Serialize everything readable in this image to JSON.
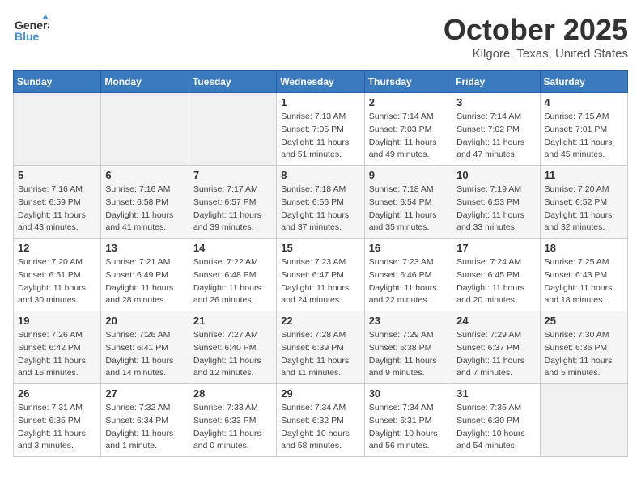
{
  "header": {
    "logo_general": "General",
    "logo_blue": "Blue",
    "month_title": "October 2025",
    "location": "Kilgore, Texas, United States"
  },
  "days_of_week": [
    "Sunday",
    "Monday",
    "Tuesday",
    "Wednesday",
    "Thursday",
    "Friday",
    "Saturday"
  ],
  "weeks": [
    [
      {
        "day": "",
        "sunrise": "",
        "sunset": "",
        "daylight": "",
        "empty": true
      },
      {
        "day": "",
        "sunrise": "",
        "sunset": "",
        "daylight": "",
        "empty": true
      },
      {
        "day": "",
        "sunrise": "",
        "sunset": "",
        "daylight": "",
        "empty": true
      },
      {
        "day": "1",
        "sunrise": "Sunrise: 7:13 AM",
        "sunset": "Sunset: 7:05 PM",
        "daylight": "Daylight: 11 hours and 51 minutes."
      },
      {
        "day": "2",
        "sunrise": "Sunrise: 7:14 AM",
        "sunset": "Sunset: 7:03 PM",
        "daylight": "Daylight: 11 hours and 49 minutes."
      },
      {
        "day": "3",
        "sunrise": "Sunrise: 7:14 AM",
        "sunset": "Sunset: 7:02 PM",
        "daylight": "Daylight: 11 hours and 47 minutes."
      },
      {
        "day": "4",
        "sunrise": "Sunrise: 7:15 AM",
        "sunset": "Sunset: 7:01 PM",
        "daylight": "Daylight: 11 hours and 45 minutes."
      }
    ],
    [
      {
        "day": "5",
        "sunrise": "Sunrise: 7:16 AM",
        "sunset": "Sunset: 6:59 PM",
        "daylight": "Daylight: 11 hours and 43 minutes."
      },
      {
        "day": "6",
        "sunrise": "Sunrise: 7:16 AM",
        "sunset": "Sunset: 6:58 PM",
        "daylight": "Daylight: 11 hours and 41 minutes."
      },
      {
        "day": "7",
        "sunrise": "Sunrise: 7:17 AM",
        "sunset": "Sunset: 6:57 PM",
        "daylight": "Daylight: 11 hours and 39 minutes."
      },
      {
        "day": "8",
        "sunrise": "Sunrise: 7:18 AM",
        "sunset": "Sunset: 6:56 PM",
        "daylight": "Daylight: 11 hours and 37 minutes."
      },
      {
        "day": "9",
        "sunrise": "Sunrise: 7:18 AM",
        "sunset": "Sunset: 6:54 PM",
        "daylight": "Daylight: 11 hours and 35 minutes."
      },
      {
        "day": "10",
        "sunrise": "Sunrise: 7:19 AM",
        "sunset": "Sunset: 6:53 PM",
        "daylight": "Daylight: 11 hours and 33 minutes."
      },
      {
        "day": "11",
        "sunrise": "Sunrise: 7:20 AM",
        "sunset": "Sunset: 6:52 PM",
        "daylight": "Daylight: 11 hours and 32 minutes."
      }
    ],
    [
      {
        "day": "12",
        "sunrise": "Sunrise: 7:20 AM",
        "sunset": "Sunset: 6:51 PM",
        "daylight": "Daylight: 11 hours and 30 minutes."
      },
      {
        "day": "13",
        "sunrise": "Sunrise: 7:21 AM",
        "sunset": "Sunset: 6:49 PM",
        "daylight": "Daylight: 11 hours and 28 minutes."
      },
      {
        "day": "14",
        "sunrise": "Sunrise: 7:22 AM",
        "sunset": "Sunset: 6:48 PM",
        "daylight": "Daylight: 11 hours and 26 minutes."
      },
      {
        "day": "15",
        "sunrise": "Sunrise: 7:23 AM",
        "sunset": "Sunset: 6:47 PM",
        "daylight": "Daylight: 11 hours and 24 minutes."
      },
      {
        "day": "16",
        "sunrise": "Sunrise: 7:23 AM",
        "sunset": "Sunset: 6:46 PM",
        "daylight": "Daylight: 11 hours and 22 minutes."
      },
      {
        "day": "17",
        "sunrise": "Sunrise: 7:24 AM",
        "sunset": "Sunset: 6:45 PM",
        "daylight": "Daylight: 11 hours and 20 minutes."
      },
      {
        "day": "18",
        "sunrise": "Sunrise: 7:25 AM",
        "sunset": "Sunset: 6:43 PM",
        "daylight": "Daylight: 11 hours and 18 minutes."
      }
    ],
    [
      {
        "day": "19",
        "sunrise": "Sunrise: 7:26 AM",
        "sunset": "Sunset: 6:42 PM",
        "daylight": "Daylight: 11 hours and 16 minutes."
      },
      {
        "day": "20",
        "sunrise": "Sunrise: 7:26 AM",
        "sunset": "Sunset: 6:41 PM",
        "daylight": "Daylight: 11 hours and 14 minutes."
      },
      {
        "day": "21",
        "sunrise": "Sunrise: 7:27 AM",
        "sunset": "Sunset: 6:40 PM",
        "daylight": "Daylight: 11 hours and 12 minutes."
      },
      {
        "day": "22",
        "sunrise": "Sunrise: 7:28 AM",
        "sunset": "Sunset: 6:39 PM",
        "daylight": "Daylight: 11 hours and 11 minutes."
      },
      {
        "day": "23",
        "sunrise": "Sunrise: 7:29 AM",
        "sunset": "Sunset: 6:38 PM",
        "daylight": "Daylight: 11 hours and 9 minutes."
      },
      {
        "day": "24",
        "sunrise": "Sunrise: 7:29 AM",
        "sunset": "Sunset: 6:37 PM",
        "daylight": "Daylight: 11 hours and 7 minutes."
      },
      {
        "day": "25",
        "sunrise": "Sunrise: 7:30 AM",
        "sunset": "Sunset: 6:36 PM",
        "daylight": "Daylight: 11 hours and 5 minutes."
      }
    ],
    [
      {
        "day": "26",
        "sunrise": "Sunrise: 7:31 AM",
        "sunset": "Sunset: 6:35 PM",
        "daylight": "Daylight: 11 hours and 3 minutes."
      },
      {
        "day": "27",
        "sunrise": "Sunrise: 7:32 AM",
        "sunset": "Sunset: 6:34 PM",
        "daylight": "Daylight: 11 hours and 1 minute."
      },
      {
        "day": "28",
        "sunrise": "Sunrise: 7:33 AM",
        "sunset": "Sunset: 6:33 PM",
        "daylight": "Daylight: 11 hours and 0 minutes."
      },
      {
        "day": "29",
        "sunrise": "Sunrise: 7:34 AM",
        "sunset": "Sunset: 6:32 PM",
        "daylight": "Daylight: 10 hours and 58 minutes."
      },
      {
        "day": "30",
        "sunrise": "Sunrise: 7:34 AM",
        "sunset": "Sunset: 6:31 PM",
        "daylight": "Daylight: 10 hours and 56 minutes."
      },
      {
        "day": "31",
        "sunrise": "Sunrise: 7:35 AM",
        "sunset": "Sunset: 6:30 PM",
        "daylight": "Daylight: 10 hours and 54 minutes."
      },
      {
        "day": "",
        "sunrise": "",
        "sunset": "",
        "daylight": "",
        "empty": true
      }
    ]
  ]
}
